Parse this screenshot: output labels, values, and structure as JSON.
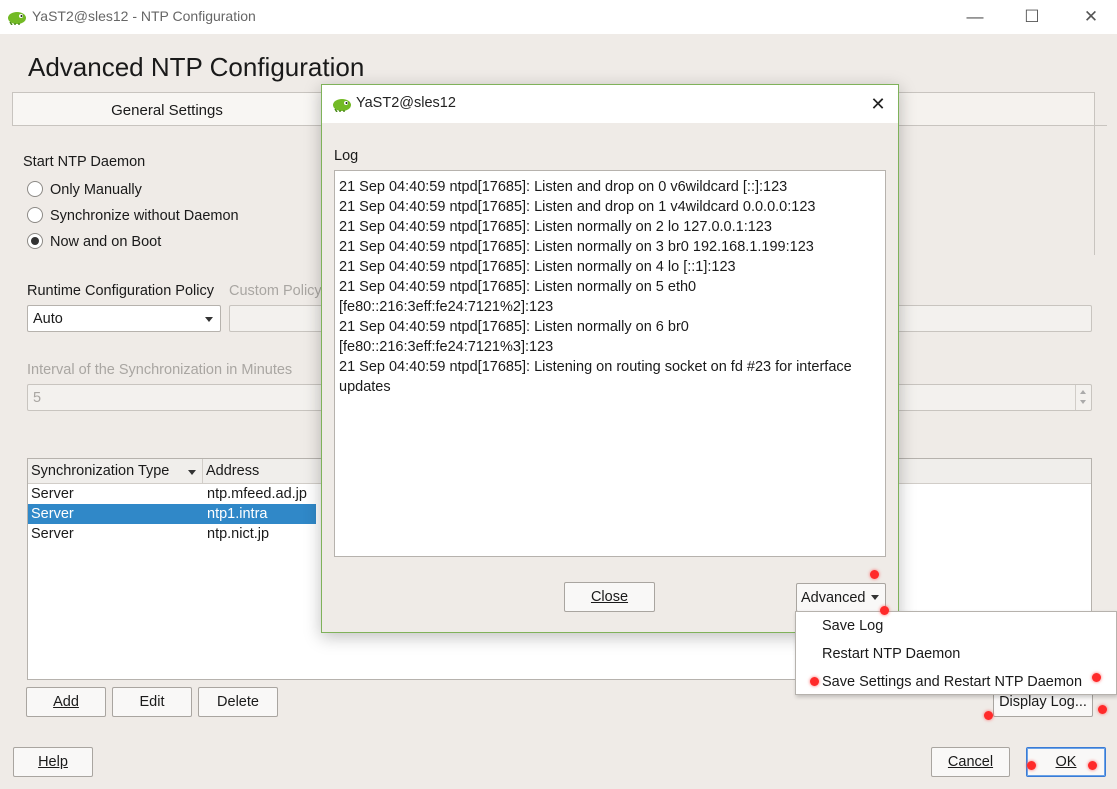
{
  "window": {
    "title": "YaST2@sles12 - NTP Configuration",
    "minimize_glyph": "—",
    "maximize_glyph": "☐",
    "close_glyph": "✕"
  },
  "page_title": "Advanced NTP Configuration",
  "tabs": [
    {
      "label": "General Settings"
    }
  ],
  "start_daemon": {
    "label": "Start NTP Daemon",
    "options": [
      {
        "label": "Only Manually",
        "checked": false
      },
      {
        "label": "Synchronize without Daemon",
        "checked": false
      },
      {
        "label": "Now and on Boot",
        "checked": true
      }
    ]
  },
  "runtime_policy": {
    "label": "Runtime Configuration Policy",
    "value": "Auto",
    "custom_label": "Custom Policy"
  },
  "interval": {
    "label": "Interval of the Synchronization in Minutes",
    "value": "5"
  },
  "sync_table": {
    "columns": [
      "Synchronization Type",
      "Address"
    ],
    "rows": [
      {
        "type": "Server",
        "address": "ntp.mfeed.ad.jp",
        "selected": false
      },
      {
        "type": "Server",
        "address": "ntp1.intra",
        "selected": true
      },
      {
        "type": "Server",
        "address": "ntp.nict.jp",
        "selected": false
      }
    ]
  },
  "table_buttons": {
    "add": "Add",
    "edit": "Edit",
    "delete": "Delete",
    "display_log": "Display Log..."
  },
  "bottom_buttons": {
    "help": "Help",
    "cancel": "Cancel",
    "ok": "OK"
  },
  "dialog": {
    "title": "YaST2@sles12",
    "close_glyph": "✕",
    "log_label": "Log",
    "log_lines": [
      "21 Sep 04:40:59 ntpd[17685]: Listen and drop on 0 v6wildcard [::]:123",
      "21 Sep 04:40:59 ntpd[17685]: Listen and drop on 1 v4wildcard 0.0.0.0:123",
      "21 Sep 04:40:59 ntpd[17685]: Listen normally on 2 lo 127.0.0.1:123",
      "21 Sep 04:40:59 ntpd[17685]: Listen normally on 3 br0 192.168.1.199:123",
      "21 Sep 04:40:59 ntpd[17685]: Listen normally on 4 lo [::1]:123",
      "21 Sep 04:40:59 ntpd[17685]: Listen normally on 5 eth0",
      "[fe80::216:3eff:fe24:7121%2]:123",
      "21 Sep 04:40:59 ntpd[17685]: Listen normally on 6 br0",
      "[fe80::216:3eff:fe24:7121%3]:123",
      "21 Sep 04:40:59 ntpd[17685]: Listening on routing socket on fd #23 for interface",
      "updates"
    ],
    "close_button": "Close",
    "advanced_button": "Advanced"
  },
  "advanced_menu": {
    "items": [
      "Save Log",
      "Restart NTP Daemon",
      "Save Settings and Restart NTP Daemon"
    ]
  },
  "colors": {
    "selection": "#3088c8",
    "dialog_border": "#7fb25a",
    "marker": "#ff2a2a"
  }
}
